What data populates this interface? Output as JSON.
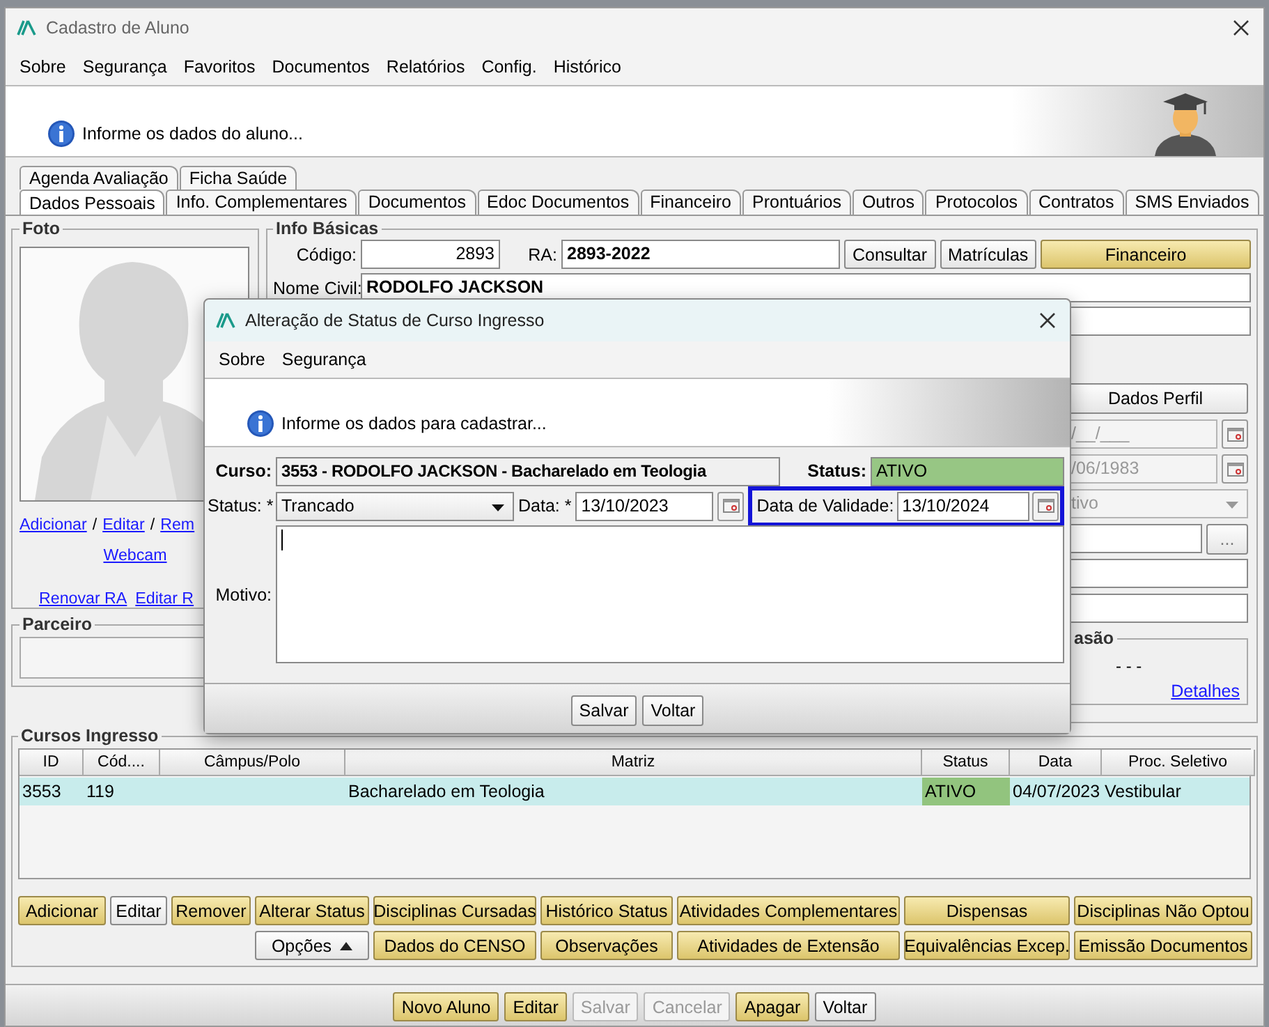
{
  "window": {
    "title": "Cadastro de Aluno"
  },
  "menu": [
    "Sobre",
    "Segurança",
    "Favoritos",
    "Documentos",
    "Relatórios",
    "Config.",
    "Histórico"
  ],
  "header": {
    "message": "Informe os dados do aluno..."
  },
  "tabs_row1": [
    {
      "label": "Agenda Avaliação",
      "selected": false
    },
    {
      "label": "Ficha Saúde",
      "selected": false
    }
  ],
  "tabs_row2": [
    {
      "label": "Dados Pessoais",
      "selected": true
    },
    {
      "label": "Info. Complementares",
      "selected": false
    },
    {
      "label": "Documentos",
      "selected": false
    },
    {
      "label": "Edoc Documentos",
      "selected": false
    },
    {
      "label": "Financeiro",
      "selected": false
    },
    {
      "label": "Prontuários",
      "selected": false
    },
    {
      "label": "Outros",
      "selected": false
    },
    {
      "label": "Protocolos",
      "selected": false
    },
    {
      "label": "Contratos",
      "selected": false
    },
    {
      "label": "SMS Enviados",
      "selected": false
    }
  ],
  "foto": {
    "title": "Foto",
    "links": [
      "Adicionar",
      "Editar",
      "Rem"
    ],
    "separator": "/",
    "webcam": "Webcam",
    "ra_links": [
      "Renovar RA",
      "Editar R"
    ]
  },
  "parceiro": {
    "title": "Parceiro"
  },
  "info_basicas": {
    "title": "Info Básicas",
    "codigo_label": "Código:",
    "codigo": "2893",
    "ra_label": "RA:",
    "ra": "2893-2022",
    "nome_civil_label": "Nome Civil:",
    "nome_civil": "RODOLFO JACKSON",
    "buttons": [
      {
        "label": "Consultar",
        "kind": "plain"
      },
      {
        "label": "Matrículas",
        "kind": "plain"
      },
      {
        "label": "Financeiro",
        "kind": "gold"
      }
    ]
  },
  "side_panel": {
    "button": "Dados Perfil",
    "fields": [
      {
        "kind": "date",
        "value": "/__/___",
        "disabled": true
      },
      {
        "kind": "date",
        "value": "/06/1983",
        "disabled": true
      },
      {
        "kind": "select",
        "value": "tivo",
        "disabled": true
      },
      {
        "kind": "lookup",
        "button": "...",
        "disabled": false
      },
      {
        "kind": "text",
        "disabled": false
      },
      {
        "kind": "text",
        "disabled": false
      }
    ],
    "group_title": "asão",
    "group_value": "- - -",
    "link": "Detalhes"
  },
  "cursos": {
    "title": "Cursos Ingresso",
    "columns": [
      "ID",
      "Cód....",
      "Câmpus/Polo",
      "Matriz",
      "Status",
      "Data",
      "Proc. Seletivo"
    ],
    "rows": [
      {
        "id": "3553",
        "cod": "119",
        "matriz": "Bacharelado em Teologia",
        "status": "ATIVO",
        "color": "#92c47e",
        "data": "04/07/2023",
        "proc": "Vestibular",
        "selected": true
      }
    ],
    "buttons_row1": [
      {
        "label": "Adicionar",
        "kind": "gold"
      },
      {
        "label": "Editar",
        "kind": "plain"
      },
      {
        "label": "Remover",
        "kind": "gold"
      },
      {
        "label": "Alterar Status",
        "kind": "gold"
      },
      {
        "label": "Disciplinas Cursadas",
        "kind": "gold"
      },
      {
        "label": "Histórico Status",
        "kind": "gold"
      },
      {
        "label": "Atividades Complementares",
        "kind": "gold"
      },
      {
        "label": "Dispensas",
        "kind": "gold"
      },
      {
        "label": "Disciplinas Não Optou",
        "kind": "gold"
      }
    ],
    "buttons_row2": [
      {
        "label": "Opções",
        "kind": "menu"
      },
      {
        "label": "Dados do CENSO",
        "kind": "gold"
      },
      {
        "label": "Observações",
        "kind": "gold"
      },
      {
        "label": "Atividades de Extensão",
        "kind": "gold"
      },
      {
        "label": "Equivalências Excep.",
        "kind": "gold"
      },
      {
        "label": "Emissão Documentos",
        "kind": "gold"
      }
    ]
  },
  "bottom_buttons": [
    {
      "label": "Novo Aluno",
      "kind": "gold",
      "disabled": false
    },
    {
      "label": "Editar",
      "kind": "gold",
      "disabled": false
    },
    {
      "label": "Salvar",
      "kind": "plain",
      "disabled": true
    },
    {
      "label": "Cancelar",
      "kind": "plain",
      "disabled": true
    },
    {
      "label": "Apagar",
      "kind": "gold",
      "disabled": false
    },
    {
      "label": "Voltar",
      "kind": "plain",
      "disabled": false
    }
  ],
  "dialog": {
    "title": "Alteração de Status de Curso Ingresso",
    "menu": [
      "Sobre",
      "Segurança"
    ],
    "message": "Informe os dados para cadastrar...",
    "curso_label": "Curso:",
    "curso": "3553 - RODOLFO JACKSON - Bacharelado em Teologia",
    "status_label": "Status:",
    "status": {
      "value": "ATIVO",
      "color": "#97c684"
    },
    "novo_status_label": "Status: *",
    "novo_status": "Trancado",
    "data_label": "Data: *",
    "data": "13/10/2023",
    "validade_label": "Data de Validade:",
    "validade": "13/10/2024",
    "validade_focused": true,
    "motivo_label": "Motivo:",
    "buttons": [
      "Salvar",
      "Voltar"
    ]
  }
}
